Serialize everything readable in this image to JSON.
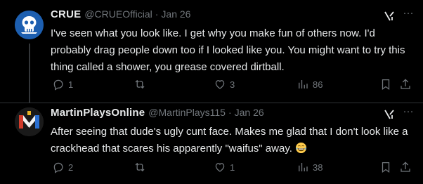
{
  "tweets": [
    {
      "name": "CRUE",
      "handle": "@CRUEOfficial",
      "separator": "·",
      "date": "Jan 26",
      "text": "I've seen what you look like. I get why you make fun of others now. I'd probably drag people down too if I looked like you. You might want to try this thing called a shower, you grease covered dirtball.",
      "reply_count": "1",
      "retweet_count": "",
      "like_count": "3",
      "view_count": "86",
      "avatar_icon": "skull-logo-icon"
    },
    {
      "name": "MartinPlaysOnline",
      "handle": "@MartinPlays115",
      "separator": "·",
      "date": "Jan 26",
      "text": "After seeing that dude's ugly cunt face. Makes me glad that I don't look like a crackhead that scares his apparently \"waifus\" away.",
      "emoji": "face-with-tears-of-joy",
      "reply_count": "2",
      "retweet_count": "",
      "like_count": "1",
      "view_count": "38",
      "avatar_icon": "m-logo-icon"
    }
  ],
  "colors": {
    "background": "#000000",
    "text": "#e7e9ea",
    "muted": "#71767b",
    "divider": "#2f3336"
  }
}
